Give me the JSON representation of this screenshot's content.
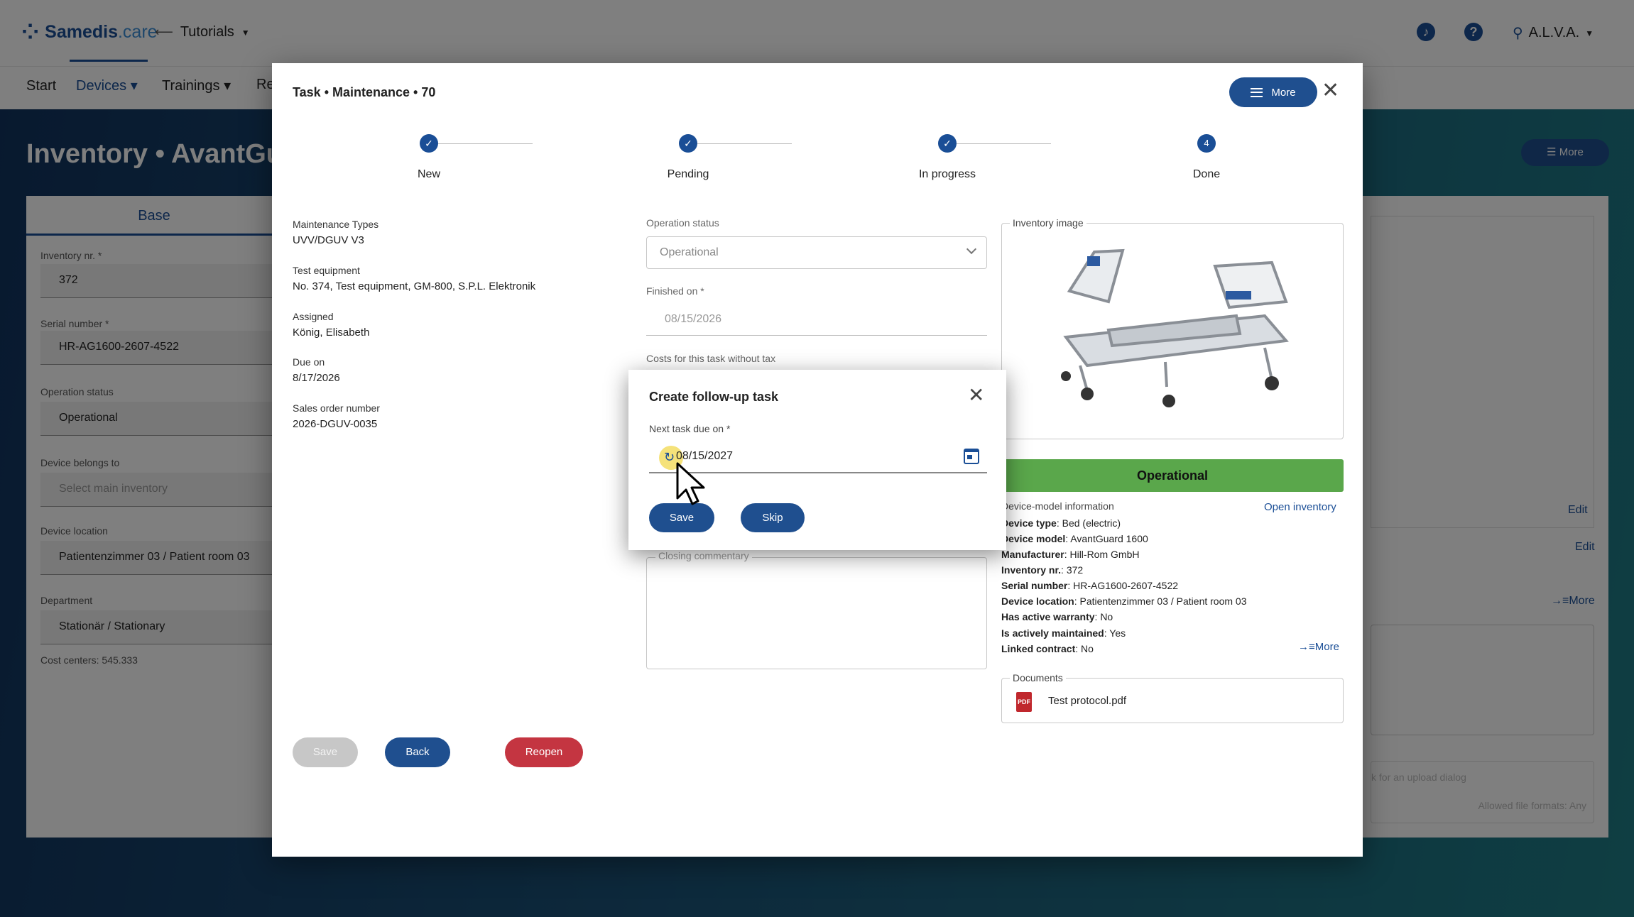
{
  "header": {
    "logo_name": "Samedis",
    "logo_tld": ".care",
    "tenant": "Tutorials",
    "user": "A.L.V.A."
  },
  "nav": {
    "start": "Start",
    "devices": "Devices",
    "trainings": "Trainings",
    "re": "Re"
  },
  "page": {
    "title": "Inventory • AvantGuard",
    "more": "More",
    "tab_base": "Base",
    "fields": [
      {
        "label": "Inventory nr. *",
        "value": "372"
      },
      {
        "label": "Serial number *",
        "value": "HR-AG1600-2607-4522"
      },
      {
        "label": "Operation status",
        "value": "Operational"
      },
      {
        "label": "Device belongs to",
        "value": "Select main inventory"
      },
      {
        "label": "Device location",
        "value": "Patientenzimmer 03 / Patient room 03"
      },
      {
        "label": "Department",
        "value": "Stationär / Stationary"
      }
    ],
    "cost_centers": "Cost centers: 545.333",
    "right_edit_1": "Edit",
    "right_edit_2": "Edit",
    "right_more": "More",
    "upload_hint": "k for an upload dialog",
    "allowed_formats": "Allowed file formats: Any"
  },
  "task": {
    "title": "Task • Maintenance • 70",
    "more": "More",
    "steps": [
      {
        "label": "New",
        "state": "done"
      },
      {
        "label": "Pending",
        "state": "done"
      },
      {
        "label": "In progress",
        "state": "done"
      },
      {
        "label": "Done",
        "state": "current",
        "number": "4"
      }
    ],
    "info": [
      {
        "label": "Maintenance Types",
        "value": "UVV/DGUV V3"
      },
      {
        "label": "Test equipment",
        "value": "No. 374, Test equipment, GM-800, S.P.L. Elektronik"
      },
      {
        "label": "Assigned",
        "value": "König, Elisabeth"
      },
      {
        "label": "Due on",
        "value": "8/17/2026"
      },
      {
        "label": "Sales order number",
        "value": "2026-DGUV-0035"
      }
    ],
    "operation_status_label": "Operation status",
    "operation_status_value": "Operational",
    "finished_on_label": "Finished on *",
    "finished_on_value": "08/15/2026",
    "costs_label": "Costs for this task without tax",
    "closing_commentary_label": "Closing commentary",
    "inventory_image_label": "Inventory image",
    "status_banner": "Operational",
    "device_model_info_label": "Device-model information",
    "open_inventory": "Open inventory",
    "device_model_rows": [
      {
        "key": "Device type",
        "value": "Bed (electric)"
      },
      {
        "key": "Device model",
        "value": "AvantGuard 1600"
      },
      {
        "key": "Manufacturer",
        "value": "Hill-Rom GmbH"
      },
      {
        "key": "Inventory nr.",
        "value": "372"
      },
      {
        "key": "Serial number",
        "value": "HR-AG1600-2607-4522"
      },
      {
        "key": "Device location",
        "value": "Patientenzimmer 03 / Patient room 03"
      },
      {
        "key": "Has active warranty",
        "value": "No"
      },
      {
        "key": "Is actively maintained",
        "value": "Yes"
      },
      {
        "key": "Linked contract",
        "value": "No"
      }
    ],
    "dm_more": "More",
    "documents_label": "Documents",
    "document_name": "Test protocol.pdf",
    "buttons": {
      "save": "Save",
      "back": "Back",
      "reopen": "Reopen"
    }
  },
  "followup": {
    "title": "Create follow-up task",
    "next_due_label": "Next task due on *",
    "next_due_value": "08/15/2027",
    "save": "Save",
    "skip": "Skip"
  },
  "colors": {
    "primary": "#1f4f8f",
    "danger": "#c43541",
    "operational": "#5aa74b"
  }
}
